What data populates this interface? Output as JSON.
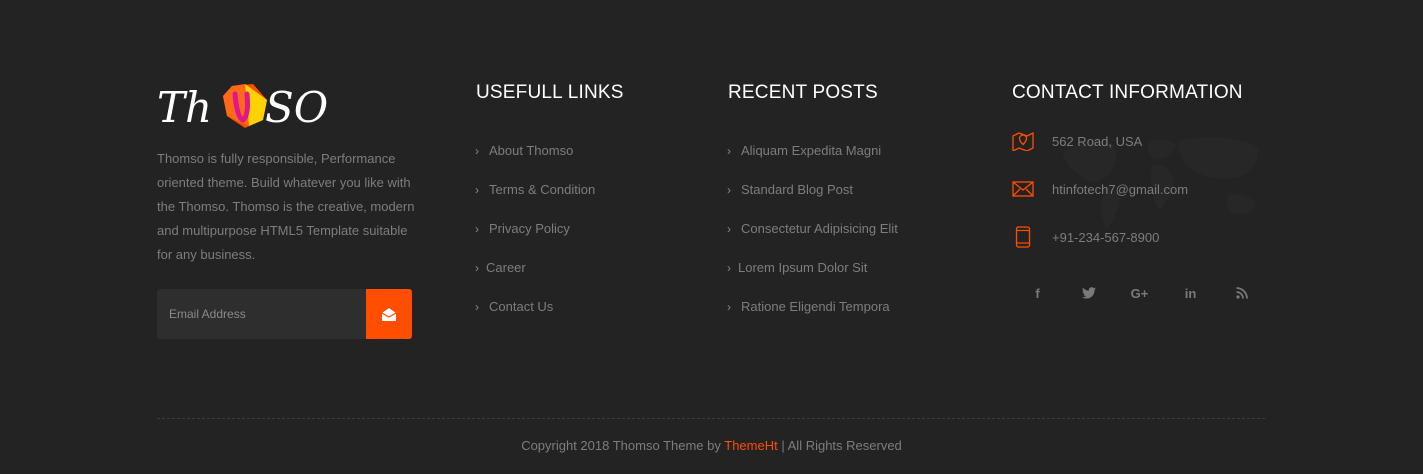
{
  "brand": {
    "logo_text": "Thomso",
    "accent": "#ff4e00"
  },
  "about": {
    "text": "Thomso is fully responsible, Performance oriented theme. Build whatever you like with the Thomso. Thomso is the creative, modern and multipurpose HTML5 Template suitable for any business."
  },
  "newsletter": {
    "placeholder": "Email Address",
    "submit_icon": "envelope-open-icon"
  },
  "useful_links": {
    "title": "USEFULL LINKS",
    "items": [
      {
        "label": "About Thomso"
      },
      {
        "label": "Terms & Condition"
      },
      {
        "label": "Privacy Policy"
      },
      {
        "label": "Career"
      },
      {
        "label": "Contact Us"
      }
    ]
  },
  "recent_posts": {
    "title": "RECENT POSTS",
    "items": [
      {
        "label": "Aliquam Expedita Magni"
      },
      {
        "label": "Standard Blog Post"
      },
      {
        "label": "Consectetur Adipisicing Elit"
      },
      {
        "label": "Lorem Ipsum Dolor Sit"
      },
      {
        "label": "Ratione Eligendi Tempora"
      }
    ]
  },
  "contact": {
    "title": "CONTACT INFORMATION",
    "address": "562 Road, USA",
    "email": "htinfotech7@gmail.com",
    "phone": "+91-234-567-8900"
  },
  "social": {
    "facebook": "f",
    "twitter": "twitter-icon",
    "googleplus": "G+",
    "linkedin": "in",
    "rss": "rss-icon"
  },
  "footer": {
    "copyright_prefix": "Copyright 2018 Thomso Theme by",
    "brand": "ThemeHt",
    "copyright_suffix": "| All Rights Reserved"
  }
}
